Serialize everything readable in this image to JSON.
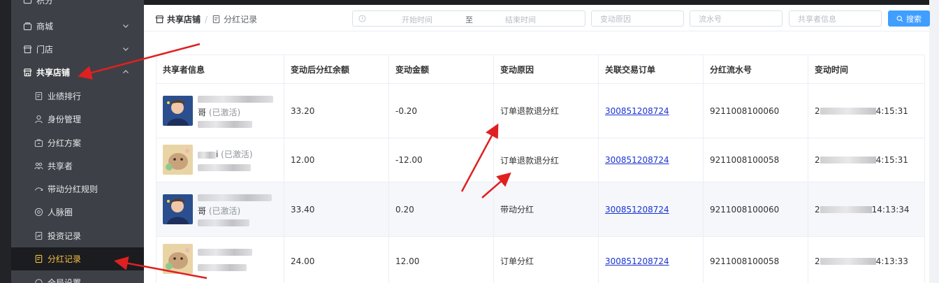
{
  "sidebar": {
    "top_partial": "积分",
    "items": [
      {
        "label": "商城",
        "icon": "shop-icon"
      },
      {
        "label": "门店",
        "icon": "store-icon"
      },
      {
        "label": "共享店铺",
        "icon": "shared-store-icon"
      }
    ],
    "sub_items": [
      {
        "label": "业绩排行",
        "icon": "ranking-icon"
      },
      {
        "label": "身份管理",
        "icon": "user-icon"
      },
      {
        "label": "分红方案",
        "icon": "plan-icon"
      },
      {
        "label": "共享者",
        "icon": "sharers-icon"
      },
      {
        "label": "带动分红规则",
        "icon": "rule-icon"
      },
      {
        "label": "人脉圈",
        "icon": "network-icon"
      },
      {
        "label": "投资记录",
        "icon": "invest-icon"
      },
      {
        "label": "分红记录",
        "icon": "record-icon"
      }
    ],
    "bottom_partial": "全局设置",
    "active_color": "#f5c045"
  },
  "breadcrumb": {
    "parent": "共享店铺",
    "current": "分红记录"
  },
  "filters": {
    "start_placeholder": "开始时间",
    "range_sep": "至",
    "end_placeholder": "结束时间",
    "reason_placeholder": "变动原因",
    "serial_placeholder": "流水号",
    "sharer_placeholder": "共享者信息",
    "search_label": "搜索"
  },
  "table": {
    "columns": [
      "共享者信息",
      "变动后分红余额",
      "变动金额",
      "变动原因",
      "关联交易订单",
      "分红流水号",
      "变动时间"
    ],
    "rows": [
      {
        "name_tail": "哥",
        "status": "(已激活)",
        "balance": "33.20",
        "amount": "-0.20",
        "reason": "订单退款退分红",
        "order": "300851208724",
        "serial": "9211008100060",
        "time_head": "2",
        "time_tail": "4:15:31"
      },
      {
        "name_tail": "i",
        "status": "(已激活)",
        "balance": "12.00",
        "amount": "-12.00",
        "reason": "订单退款退分红",
        "order": "300851208724",
        "serial": "9211008100058",
        "time_head": "2",
        "time_tail": "4:15:31"
      },
      {
        "name_tail": "哥",
        "status": "(已激活)",
        "balance": "33.40",
        "amount": "0.20",
        "reason": "带动分红",
        "order": "300851208724",
        "serial": "9211008100060",
        "time_head": "2",
        "time_tail": "14:13:34"
      },
      {
        "name_tail": "",
        "status": "",
        "balance": "24.00",
        "amount": "12.00",
        "reason": "订单分红",
        "order": "300851208724",
        "serial": "9211008100058",
        "time_head": "2",
        "time_tail": "4:13:33"
      }
    ]
  },
  "colors": {
    "accent": "#409eff",
    "link": "#1a33d1",
    "annotation_arrow": "#e02020"
  }
}
